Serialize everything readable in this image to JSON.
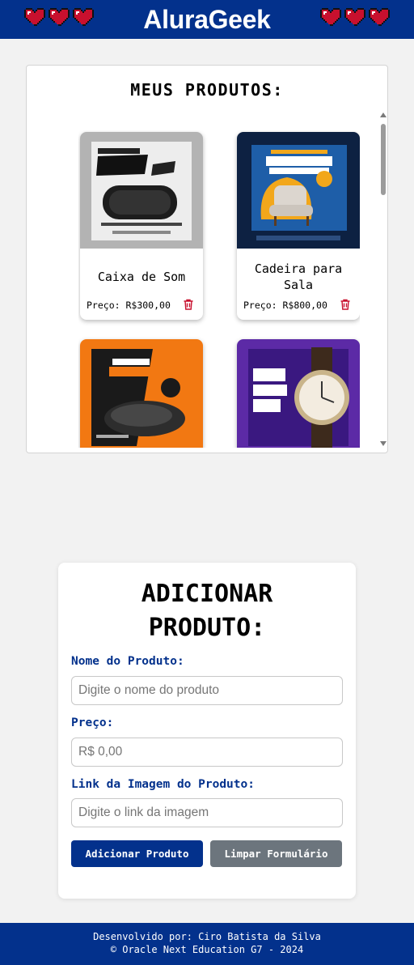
{
  "header": {
    "logo": "AluraGeek",
    "heart_color": "#c8102e"
  },
  "products": {
    "title": "MEUS PRODUTOS:",
    "price_label": "Preço:",
    "items": [
      {
        "name": "Caixa de Som",
        "price": "R$300,00",
        "image_caption": "BLACK FRIDAY 50% OFF"
      },
      {
        "name": "Cadeira para Sala",
        "price": "R$800,00",
        "image_caption": "FURNITURE FOR SALE 50% OFF"
      },
      {
        "name": "",
        "price": "",
        "image_caption": "SPECIAL BLACK Friday 50% OFF"
      },
      {
        "name": "",
        "price": "",
        "image_caption": "Black FRIDAY SALE 50% OFF"
      }
    ]
  },
  "form": {
    "title": "ADICIONAR PRODUTO:",
    "name_label": "Nome do Produto:",
    "name_placeholder": "Digite o nome do produto",
    "price_label": "Preço:",
    "price_placeholder": "R$ 0,00",
    "image_label": "Link da Imagem do Produto:",
    "image_placeholder": "Digite o link da imagem",
    "submit_label": "Adicionar Produto",
    "clear_label": "Limpar Formulário"
  },
  "footer": {
    "line1": "Desenvolvido por: Ciro Batista da Silva",
    "line2": "© Oracle Next Education G7 - 2024"
  },
  "colors": {
    "brand": "#03318c",
    "delete_icon": "#c8102e",
    "clear_button": "#6c757d"
  }
}
